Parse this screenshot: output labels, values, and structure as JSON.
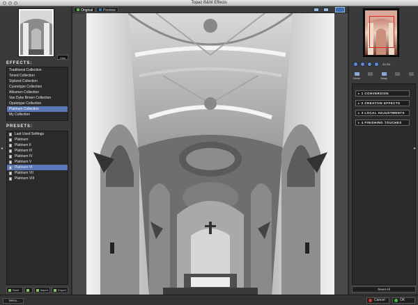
{
  "window": {
    "title": "Topaz B&W Effects"
  },
  "left_panel": {
    "hide_label": "Hide",
    "effects_title": "EFFECTS:",
    "collections": [
      "Traditional Collection",
      "Toned Collection",
      "Stylized Collection",
      "Cyanotype Collection",
      "Albumen Collection",
      "Van Dyke Brown Collection",
      "Opalotype Collection",
      "Platinum Collection",
      "My Collection"
    ],
    "selected_collection_index": 7,
    "presets_title": "PRESETS:",
    "presets": [
      "Last Used Settings",
      "Platinum",
      "Platinum II",
      "Platinum III",
      "Platinum IV",
      "Platinum V",
      "Platinum VI",
      "Platinum VII",
      "Platinum VIII"
    ],
    "selected_preset_index": 6,
    "buttons": {
      "save": "Save",
      "import": "Import",
      "export": "Export"
    }
  },
  "viewer": {
    "tab_original": "Original",
    "tab_preview": "Preview"
  },
  "right_panel": {
    "zoom_level": "33.3%",
    "tools": {
      "undo": "Undo",
      "snap": "Snap"
    },
    "steps": [
      "1 CONVERSION",
      "2 CREATIVE EFFECTS",
      "3 LOCAL ADJUSTMENTS",
      "4 FINISHING TOUCHES"
    ],
    "reset_label": "Reset All"
  },
  "statusbar": {
    "menu": "Menu...",
    "cancel": "Cancel",
    "ok": "OK"
  },
  "colors": {
    "selection": "#5a79b8",
    "background": "#3a3a3a",
    "ok_green": "#44bb44",
    "cancel_red": "#dd3333"
  }
}
